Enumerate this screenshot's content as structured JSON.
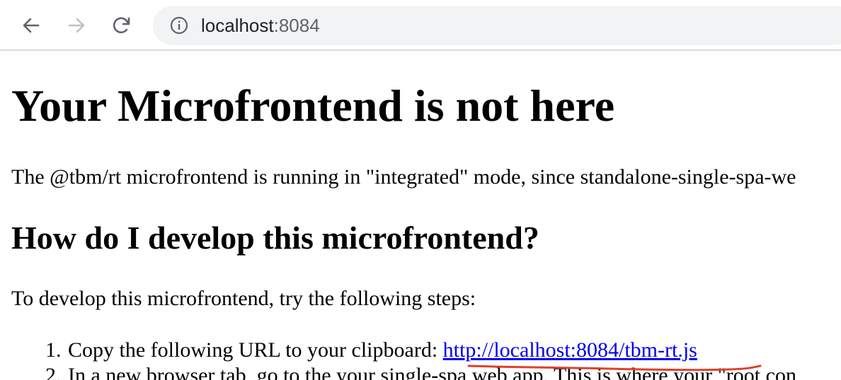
{
  "browser": {
    "url_host": "localhost",
    "url_port": ":8084"
  },
  "icons": {
    "back": "arrow-left-icon",
    "forward": "arrow-right-icon",
    "reload": "reload-icon",
    "site_info": "info-icon"
  },
  "colors": {
    "link": "#0000ee",
    "annotation": "#e0402a",
    "omnibox_bg": "#f1f3f4"
  },
  "page": {
    "title": "Your Microfrontend is not here",
    "intro": "The @tbm/rt microfrontend is running in \"integrated\" mode, since standalone-single-spa-we",
    "subtitle": "How do I develop this microfrontend?",
    "steps_intro": "To develop this microfrontend, try the following steps:",
    "steps": [
      {
        "number": "1.",
        "text": "Copy the following URL to your clipboard:",
        "link": "http://localhost:8084/tbm-rt.js"
      },
      {
        "number": "2.",
        "text": "In a new browser tab, go to the your single-spa web app. This is where your \"root con"
      }
    ]
  }
}
